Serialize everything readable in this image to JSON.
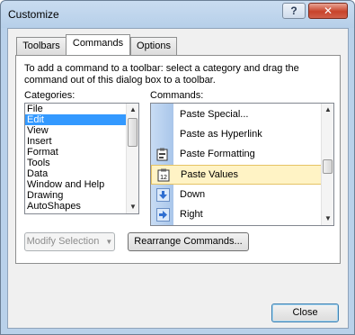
{
  "window": {
    "title": "Customize",
    "help_glyph": "?",
    "close_glyph": "✕"
  },
  "tabs": [
    {
      "label": "Toolbars",
      "active": false
    },
    {
      "label": "Commands",
      "active": true
    },
    {
      "label": "Options",
      "active": false
    }
  ],
  "description": "To add a command to a toolbar: select a category and drag the command out of this dialog box to a toolbar.",
  "categories": {
    "label": "Categories:",
    "items": [
      "File",
      "Edit",
      "View",
      "Insert",
      "Format",
      "Tools",
      "Data",
      "Window and Help",
      "Drawing",
      "AutoShapes"
    ],
    "selected": "Edit"
  },
  "commands": {
    "label": "Commands:",
    "items": [
      {
        "label": "Paste Special...",
        "icon": "none"
      },
      {
        "label": "Paste as Hyperlink",
        "icon": "none"
      },
      {
        "label": "Paste Formatting",
        "icon": "paste-formatting-icon"
      },
      {
        "label": "Paste Values",
        "icon": "paste-values-icon"
      },
      {
        "label": "Down",
        "icon": "arrow-down-icon"
      },
      {
        "label": "Right",
        "icon": "arrow-right-icon"
      }
    ],
    "highlighted": "Paste Values"
  },
  "buttons": {
    "modify_selection": "Modify Selection",
    "rearrange_commands": "Rearrange Commands...",
    "close": "Close"
  },
  "colors": {
    "selection": "#3399ff",
    "highlight_fill": "#fff3c5",
    "highlight_border": "#e5c365"
  }
}
